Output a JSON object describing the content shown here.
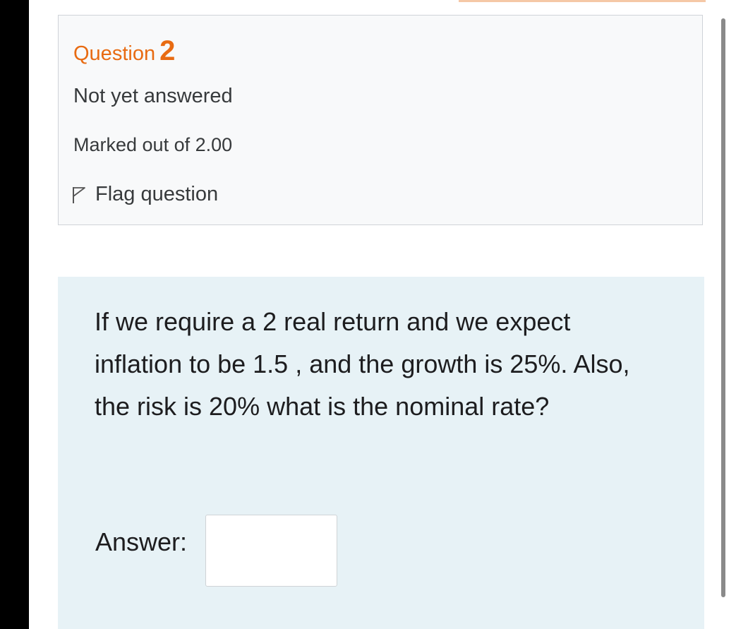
{
  "question_info": {
    "label": "Question",
    "number": "2",
    "status": "Not yet answered",
    "marks": "Marked out of 2.00",
    "flag_label": "Flag question"
  },
  "question": {
    "text": "If we require a 2 real return and we expect inflation to be 1.5 , and the growth is 25%. Also, the risk is 20% what is the nominal rate?",
    "answer_label": "Answer:",
    "answer_value": ""
  },
  "icons": {
    "flag": "flag-outline-icon"
  },
  "colors": {
    "accent": "#e86b12",
    "info_background": "#f8f9fa",
    "question_background": "#e7f2f6",
    "text": "#373a3c"
  }
}
